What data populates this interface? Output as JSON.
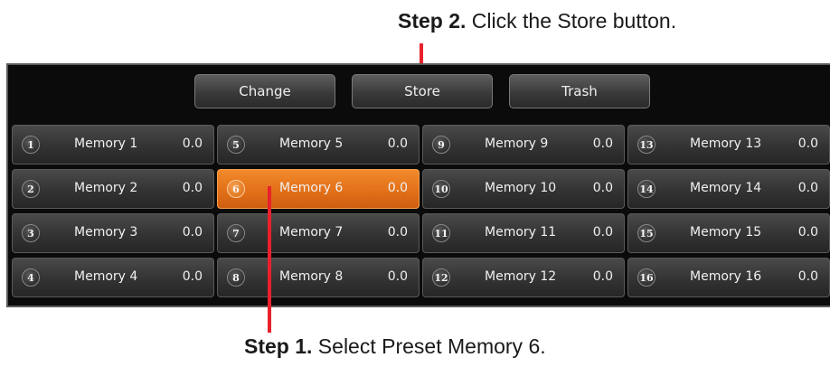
{
  "callouts": {
    "step2_bold": "Step 2.",
    "step2_text": " Click the Store button.",
    "step1_bold": "Step 1.",
    "step1_text": " Select Preset Memory 6."
  },
  "toolbar": {
    "change_label": "Change",
    "store_label": "Store",
    "trash_label": "Trash"
  },
  "memories": [
    {
      "num": "1",
      "name": "Memory 1",
      "value": "0.0"
    },
    {
      "num": "2",
      "name": "Memory 2",
      "value": "0.0"
    },
    {
      "num": "3",
      "name": "Memory 3",
      "value": "0.0"
    },
    {
      "num": "4",
      "name": "Memory 4",
      "value": "0.0"
    },
    {
      "num": "5",
      "name": "Memory 5",
      "value": "0.0"
    },
    {
      "num": "6",
      "name": "Memory 6",
      "value": "0.0"
    },
    {
      "num": "7",
      "name": "Memory 7",
      "value": "0.0"
    },
    {
      "num": "8",
      "name": "Memory 8",
      "value": "0.0"
    },
    {
      "num": "9",
      "name": "Memory 9",
      "value": "0.0"
    },
    {
      "num": "10",
      "name": "Memory 10",
      "value": "0.0"
    },
    {
      "num": "11",
      "name": "Memory 11",
      "value": "0.0"
    },
    {
      "num": "12",
      "name": "Memory 12",
      "value": "0.0"
    },
    {
      "num": "13",
      "name": "Memory 13",
      "value": "0.0"
    },
    {
      "num": "14",
      "name": "Memory 14",
      "value": "0.0"
    },
    {
      "num": "15",
      "name": "Memory 15",
      "value": "0.0"
    },
    {
      "num": "16",
      "name": "Memory 16",
      "value": "0.0"
    }
  ],
  "selected_memory": "6",
  "colors": {
    "accent": "#e2701a",
    "pointer": "#e8212a",
    "panel_bg": "#0b0b0b"
  }
}
